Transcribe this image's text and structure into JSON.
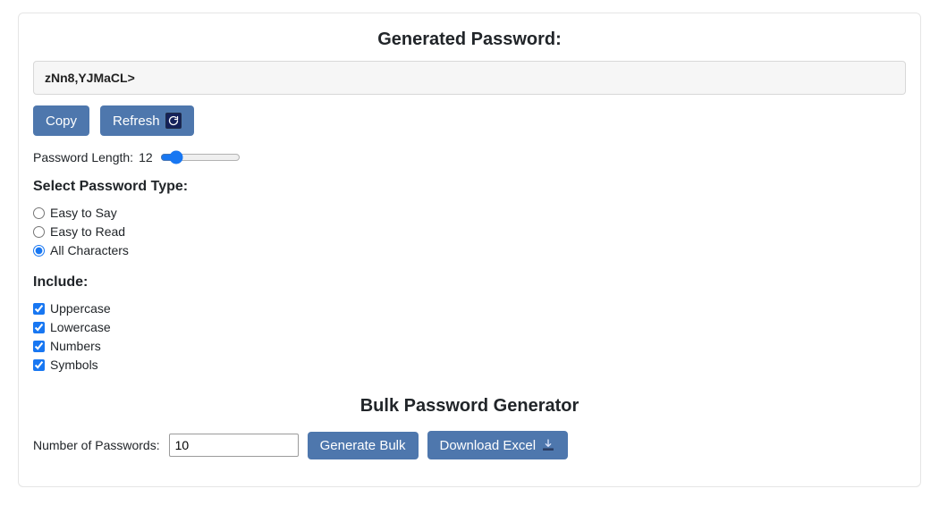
{
  "header": {
    "title": "Generated Password:"
  },
  "password": {
    "value": "zNn8,YJMaCL>"
  },
  "actions": {
    "copy": "Copy",
    "refresh": "Refresh"
  },
  "length": {
    "label": "Password Length:",
    "value": "12"
  },
  "typeSection": {
    "heading": "Select Password Type:",
    "options": [
      {
        "label": "Easy to Say",
        "checked": false
      },
      {
        "label": "Easy to Read",
        "checked": false
      },
      {
        "label": "All Characters",
        "checked": true
      }
    ]
  },
  "includeSection": {
    "heading": "Include:",
    "options": [
      {
        "label": "Uppercase",
        "checked": true
      },
      {
        "label": "Lowercase",
        "checked": true
      },
      {
        "label": "Numbers",
        "checked": true
      },
      {
        "label": "Symbols",
        "checked": true
      }
    ]
  },
  "bulk": {
    "title": "Bulk Password Generator",
    "countLabel": "Number of Passwords:",
    "countValue": "10",
    "generate": "Generate Bulk",
    "download": "Download Excel"
  }
}
